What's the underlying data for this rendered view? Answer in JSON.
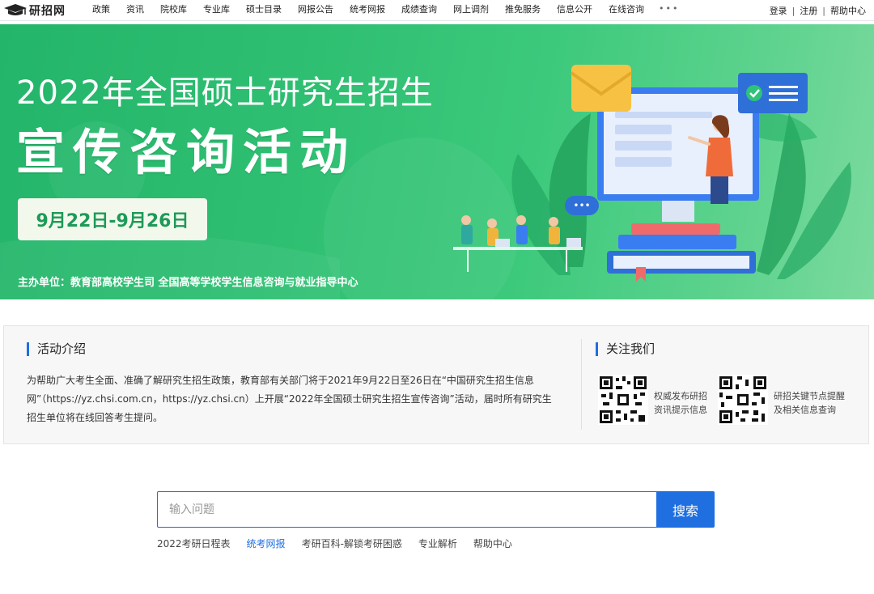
{
  "nav": {
    "logo_text": "研招网",
    "items": [
      "政策",
      "资讯",
      "院校库",
      "专业库",
      "硕士目录",
      "网报公告",
      "统考网报",
      "成绩查询",
      "网上调剂",
      "推免服务",
      "信息公开",
      "在线咨询"
    ],
    "more": "•••",
    "login": "登录",
    "register": "注册",
    "help": "帮助中心",
    "sep": "|"
  },
  "banner": {
    "title_line1": "2022年全国硕士研究生招生",
    "title_line2": "宣传咨询活动",
    "date_range": "9月22日-9月26日",
    "host": "主办单位：教育部高校学生司  全国高等学校学生信息咨询与就业指导中心",
    "chat_bubble": "•••"
  },
  "intro": {
    "title": "活动介绍",
    "text": "为帮助广大考生全面、准确了解研究生招生政策，教育部有关部门将于2021年9月22日至26日在“中国研究生招生信息网”（https://yz.chsi.com.cn，https://yz.chsi.cn）上开展“2022年全国硕士研究生招生宣传咨询”活动，届时所有研究生招生单位将在线回答考生提问。"
  },
  "follow": {
    "title": "关注我们",
    "qr1_caption_line1": "权威发布研招",
    "qr1_caption_line2": "资讯提示信息",
    "qr2_caption_line1": "研招关键节点提醒",
    "qr2_caption_line2": "及相关信息查询"
  },
  "search": {
    "placeholder": "输入问题",
    "button": "搜索"
  },
  "quick_links": [
    "2022考研日程表",
    "统考网报",
    "考研百科-解锁考研困惑",
    "专业解析",
    "帮助中心"
  ],
  "colors": {
    "accent_blue": "#1f6fe0",
    "banner_green": "#2fbf72",
    "date_green": "#1d9a57"
  }
}
